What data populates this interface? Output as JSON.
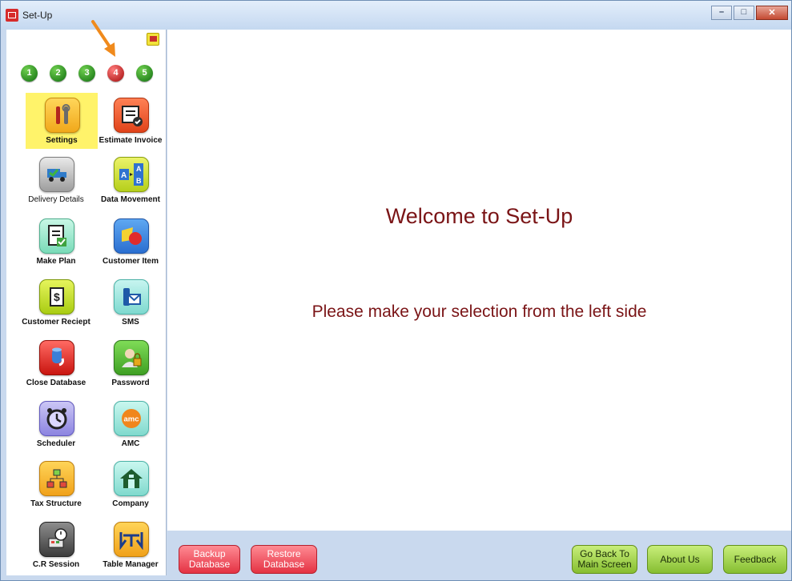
{
  "window": {
    "title": "Set-Up"
  },
  "window_controls": {
    "minimize": "–",
    "maximize": "□",
    "close": "✕"
  },
  "steps": [
    "1",
    "2",
    "3",
    "4",
    "5"
  ],
  "active_step": "4",
  "tiles": [
    {
      "label": "Settings",
      "icon": "wrench-screwdriver-icon",
      "selected": true
    },
    {
      "label": "Estimate Invoice",
      "icon": "invoice-check-icon"
    },
    {
      "label": "Delivery Details",
      "icon": "delivery-truck-icon"
    },
    {
      "label": "Data Movement",
      "icon": "data-movement-icon"
    },
    {
      "label": "Make Plan",
      "icon": "clipboard-check-icon"
    },
    {
      "label": "Customer Item",
      "icon": "shapes-icon"
    },
    {
      "label": "Customer Reciept",
      "icon": "receipt-icon"
    },
    {
      "label": "SMS",
      "icon": "phone-message-icon"
    },
    {
      "label": "Close Database",
      "icon": "close-database-icon"
    },
    {
      "label": "Password",
      "icon": "user-lock-icon"
    },
    {
      "label": "Scheduler",
      "icon": "alarm-clock-icon"
    },
    {
      "label": "AMC",
      "icon": "amc-icon"
    },
    {
      "label": "Tax Structure",
      "icon": "org-chart-icon"
    },
    {
      "label": "Company",
      "icon": "house-icon"
    },
    {
      "label": "C.R Session",
      "icon": "cash-register-icon"
    },
    {
      "label": "Table Manager",
      "icon": "table-chairs-icon"
    }
  ],
  "main": {
    "welcome": "Welcome to Set-Up",
    "hint": "Please make your selection from the left side"
  },
  "buttons": {
    "backup_line1": "Backup",
    "backup_line2": "Database",
    "restore_line1": "Restore",
    "restore_line2": "Database",
    "goback_line1": "Go Back To",
    "goback_line2": "Main Screen",
    "about": "About Us",
    "feedback": "Feedback"
  }
}
